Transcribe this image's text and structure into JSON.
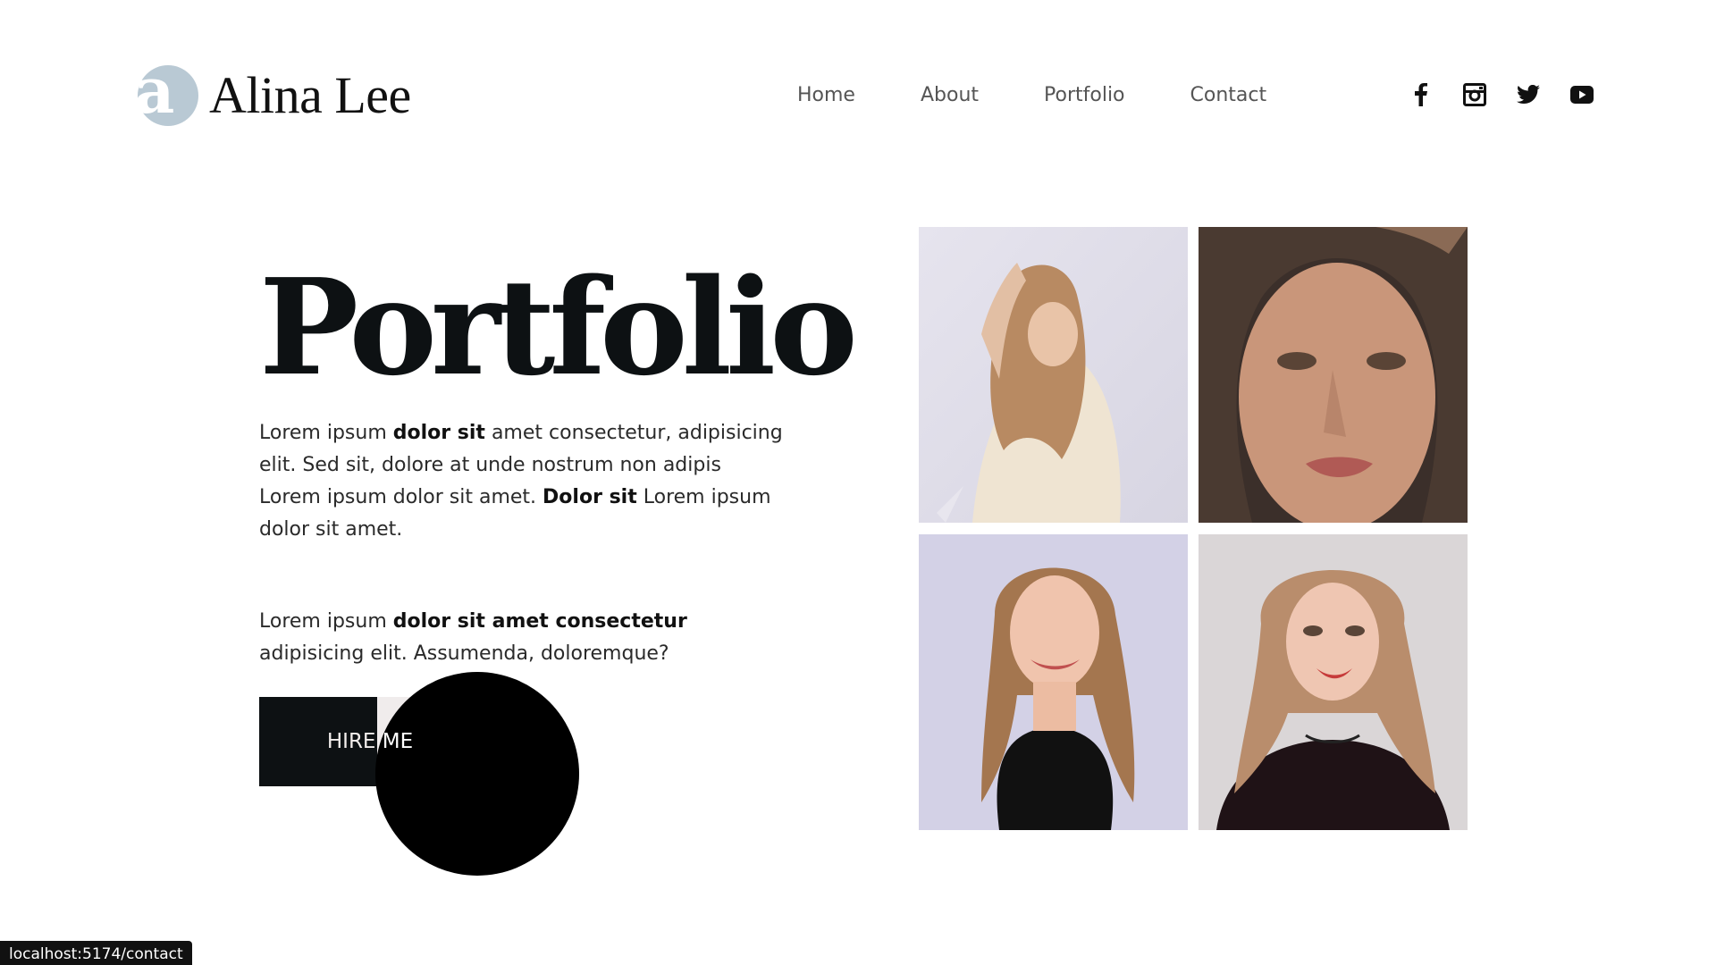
{
  "brand": {
    "logo_letter": "a",
    "name": "Alina Lee",
    "mark_color": "#b9c9d4"
  },
  "nav": {
    "items": [
      {
        "label": "Home"
      },
      {
        "label": "About"
      },
      {
        "label": "Portfolio"
      },
      {
        "label": "Contact"
      }
    ]
  },
  "social": {
    "icons": [
      "facebook-icon",
      "instagram-icon",
      "twitter-icon",
      "youtube-icon"
    ]
  },
  "hero": {
    "title": "Portfolio",
    "para1": {
      "t1": "Lorem ipsum ",
      "b1": "dolor sit",
      "t2": " amet consectetur, adipisicing elit. Sed sit, dolore at unde nostrum non adipis Lorem ipsum dolor sit amet. ",
      "b2": "Dolor sit",
      "t3": " Lorem ipsum dolor sit amet."
    },
    "para2": {
      "t1": "Lorem ipsum ",
      "b1": "dolor sit amet consectetur",
      "t2": " adipisicing elit. Assumenda, doloremque?"
    },
    "cta_label": "HIRE ME"
  },
  "gallery": {
    "photos": [
      {
        "name": "portfolio-photo-1"
      },
      {
        "name": "portfolio-photo-2"
      },
      {
        "name": "portfolio-photo-3"
      },
      {
        "name": "portfolio-photo-4"
      }
    ]
  },
  "status_bar": {
    "url": "localhost:5174/contact"
  }
}
